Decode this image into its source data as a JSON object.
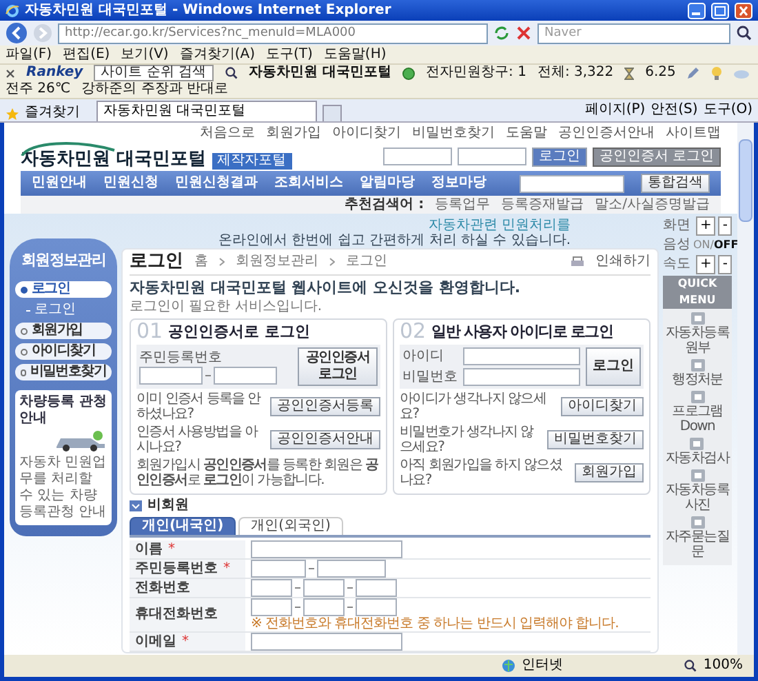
{
  "window": {
    "title": "자동차민원 대국민포털 - Windows Internet Explorer"
  },
  "address_bar": {
    "url": "http://ecar.go.kr/Services?nc_menuId=MLA000",
    "search_placeholder": "Naver"
  },
  "menu_bar": [
    "파일(F)",
    "편집(E)",
    "보기(V)",
    "즐겨찾기(A)",
    "도구(T)",
    "도움말(H)"
  ],
  "toolbar": {
    "brand": "Rankey",
    "search_value": "사이트 순위 검색",
    "site": "자동차민원 대국민포털",
    "counter": "전자민원창구: 1",
    "total": "전체: 3,322",
    "score": "6.25",
    "weather": "전주 26℃",
    "news": "강하준의 주장과 반대로"
  },
  "tab_bar": {
    "favorites": "즐겨찾기",
    "tabs": [
      {
        "label": "자동차민원 대국민포털",
        "selected": true
      }
    ],
    "commands": [
      "페이지(P)",
      "안전(S)",
      "도구(O)"
    ]
  },
  "header": {
    "logo": "자동차민원 대국민포털",
    "logo_badge": "제작자포털",
    "top_links": [
      "처음으로",
      "회원가입",
      "아이디찾기",
      "비밀번호찾기",
      "도움말",
      "공인인증서안내",
      "사이트맵"
    ],
    "login_buttons": [
      "로그인",
      "공인인증서 로그인"
    ]
  },
  "nav": {
    "items": [
      "민원안내",
      "민원신청",
      "민원신청결과",
      "조회서비스",
      "알림마당",
      "정보마당"
    ],
    "search_button": "통합검색",
    "keywords_label": "추천검색어 :",
    "keywords": [
      "등록업무",
      "등록증재발급",
      "말소/사실증명발급"
    ]
  },
  "banner": {
    "line1": "자동차관련 민원처리를",
    "line2": "온라인에서 한번에 쉽고 간편하게 처리 하실 수 있습니다."
  },
  "sidebar": {
    "title": "회원정보관리",
    "items": [
      {
        "label": "로그인",
        "selected": true,
        "children": [
          {
            "label": "로그인",
            "selected": true
          }
        ]
      },
      {
        "label": "회원가입",
        "selected": false
      },
      {
        "label": "아이디찾기",
        "selected": false
      },
      {
        "label": "비밀번호찾기",
        "selected": false
      }
    ],
    "promo": {
      "title": "차량등록 관청 안내",
      "text": "자동차 민원업무를 처리할 수 있는 차량등록관청 안내"
    }
  },
  "main": {
    "title": "로그인",
    "breadcrumb": [
      "홈",
      "회원정보관리",
      "로그인"
    ],
    "print": "인쇄하기",
    "welcome": "자동차민원 대국민포털 웹사이트에 오신것을 환영합니다.",
    "subtitle": "로그인이 필요한 서비스입니다."
  },
  "cert_login": {
    "number": "01",
    "title": "공인인증서로 로그인",
    "field_label": "주민등록번호",
    "button": "공인인증서 로그인",
    "links": [
      {
        "text": "이미 인증서 등록을 안하셨나요?",
        "button": "공인인증서등록"
      },
      {
        "text": "인증서 사용방법을 아시나요?",
        "button": "공인인증서안내"
      }
    ],
    "note": "회원가입시 **공인인증서**를 등록한 회원은 **공인인증서**로 **로그인**이 가능합니다."
  },
  "id_login": {
    "number": "02",
    "title": "일반 사용자 아이디로 로그인",
    "id_label": "아이디",
    "pw_label": "비밀번호",
    "button": "로그인",
    "links": [
      {
        "text": "아이디가 생각나지 않으세요?",
        "button": "아이디찾기"
      },
      {
        "text": "비밀번호가 생각나지 않으세요?",
        "button": "비밀번호찾기"
      },
      {
        "text": "아직 회원가입을 하지 않으셨나요?",
        "button": "회원가입"
      }
    ]
  },
  "guest": {
    "title": "비회원",
    "tabs": [
      {
        "label": "개인(내국인)",
        "selected": true
      },
      {
        "label": "개인(외국인)",
        "selected": false
      }
    ],
    "rows": [
      {
        "label": "이름",
        "mark": "*",
        "kind": "single"
      },
      {
        "label": "주민등록번호",
        "mark": "*",
        "kind": "split2"
      },
      {
        "label": "전화번호",
        "kind": "split3"
      },
      {
        "label": "휴대전화번호",
        "kind": "split3",
        "note": "※ 전화번호와 휴대전화번호 중 하나는 반드시 입력해야 합니다."
      },
      {
        "label": "이메일",
        "mark": "*",
        "kind": "single"
      }
    ]
  },
  "quick": {
    "zoom_label": "화면",
    "plus": "+",
    "minus": "-",
    "voice_label": "음성",
    "voice_on": "ON",
    "voice_separator": "/",
    "voice_off": "OFF",
    "voice_enabled": false,
    "speed_label": "속도",
    "title": "QUICK MENU",
    "items": [
      "자동차등록원부",
      "행정처분",
      "프로그램 Down",
      "자동차검사",
      "자동차등록사진",
      "자주묻는질문"
    ]
  },
  "status_bar": {
    "zone": "인터넷",
    "zoom": "100%"
  }
}
